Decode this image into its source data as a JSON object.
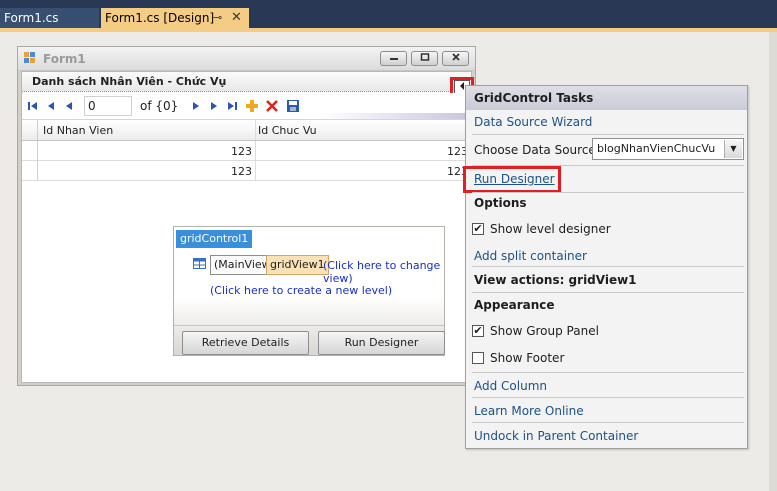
{
  "tabs": [
    {
      "label": "Form1.cs"
    },
    {
      "label": "Form1.cs [Design]"
    }
  ],
  "tab_pin_glyph": "⊸",
  "tab_close_glyph": "✕",
  "form": {
    "title": "Form1",
    "grid_caption": "Danh sách Nhân Viên - Chức Vụ",
    "navigator": {
      "position_value": "0",
      "of_label": "of {0}"
    },
    "columns": [
      "Id Nhan Vien",
      "Id Chuc Vu"
    ],
    "rows": [
      [
        "123",
        "123"
      ],
      [
        "123",
        "123"
      ]
    ]
  },
  "level_designer": {
    "label": "gridControl1",
    "main_view": "(MainView)",
    "grid_view": "gridView1",
    "change_view_link": "(Click here to change view)",
    "create_level_link": "(Click here to create a new level)",
    "retrieve_button": "Retrieve Details",
    "run_button": "Run Designer"
  },
  "tasks": {
    "header": "GridControl Tasks",
    "data_source_wizard": "Data Source Wizard",
    "choose_data_source_label": "Choose Data Source",
    "data_source_value": "blogNhanVienChucVu",
    "run_designer": "Run Designer",
    "options_title": "Options",
    "show_level_designer": "Show level designer",
    "add_split_container": "Add split container",
    "view_actions": "View actions: gridView1",
    "appearance_title": "Appearance",
    "show_group_panel": "Show Group Panel",
    "show_footer": "Show Footer",
    "add_column": "Add Column",
    "learn_more": "Learn More Online",
    "undock": "Undock in Parent Container",
    "show_level_designer_checked": true,
    "show_group_panel_checked": true,
    "show_footer_checked": false
  },
  "colors": {
    "tab_strip": "#293955",
    "active_tab": "#f5cc84",
    "highlight_red": "#e01f25",
    "link_blue": "#1c5288",
    "selection_blue": "#3a8fdc"
  }
}
